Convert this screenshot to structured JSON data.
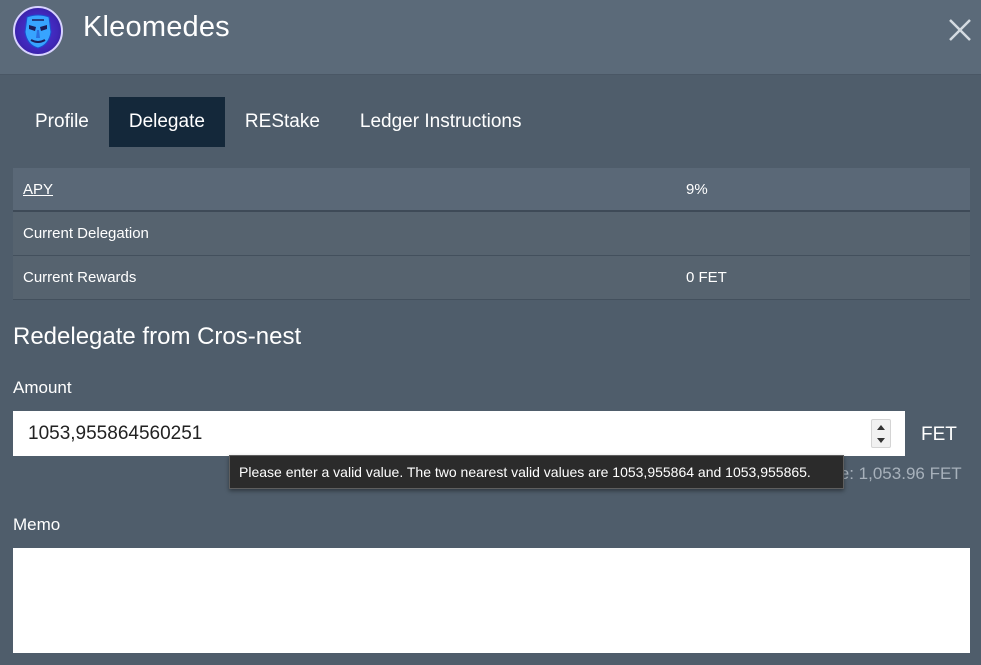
{
  "header": {
    "title": "Kleomedes",
    "avatar_icon": "kleomedes-mask-logo",
    "close_icon": "close-icon"
  },
  "tabs": [
    {
      "label": "Profile",
      "active": false
    },
    {
      "label": "Delegate",
      "active": true
    },
    {
      "label": "REStake",
      "active": false
    },
    {
      "label": "Ledger Instructions",
      "active": false
    }
  ],
  "info": {
    "apy_label": "APY",
    "apy_value": "9%",
    "current_delegation_label": "Current Delegation",
    "current_delegation_value": "",
    "current_rewards_label": "Current Rewards",
    "current_rewards_value": "0 FET"
  },
  "form": {
    "section_title": "Redelegate from Cros-nest",
    "amount_label": "Amount",
    "amount_value": "1053,955864560251",
    "unit": "FET",
    "available_text": "le: 1,053.96 FET",
    "tooltip_text": "Please enter a valid value. The two nearest valid values are 1053,955864 and 1053,955865.",
    "memo_label": "Memo",
    "memo_value": ""
  },
  "colors": {
    "background": "#4f5d6b",
    "header": "#5b6a79",
    "active_tab": "#14283a",
    "table_row": "#5a6877",
    "tooltip": "#2b2b2b"
  }
}
